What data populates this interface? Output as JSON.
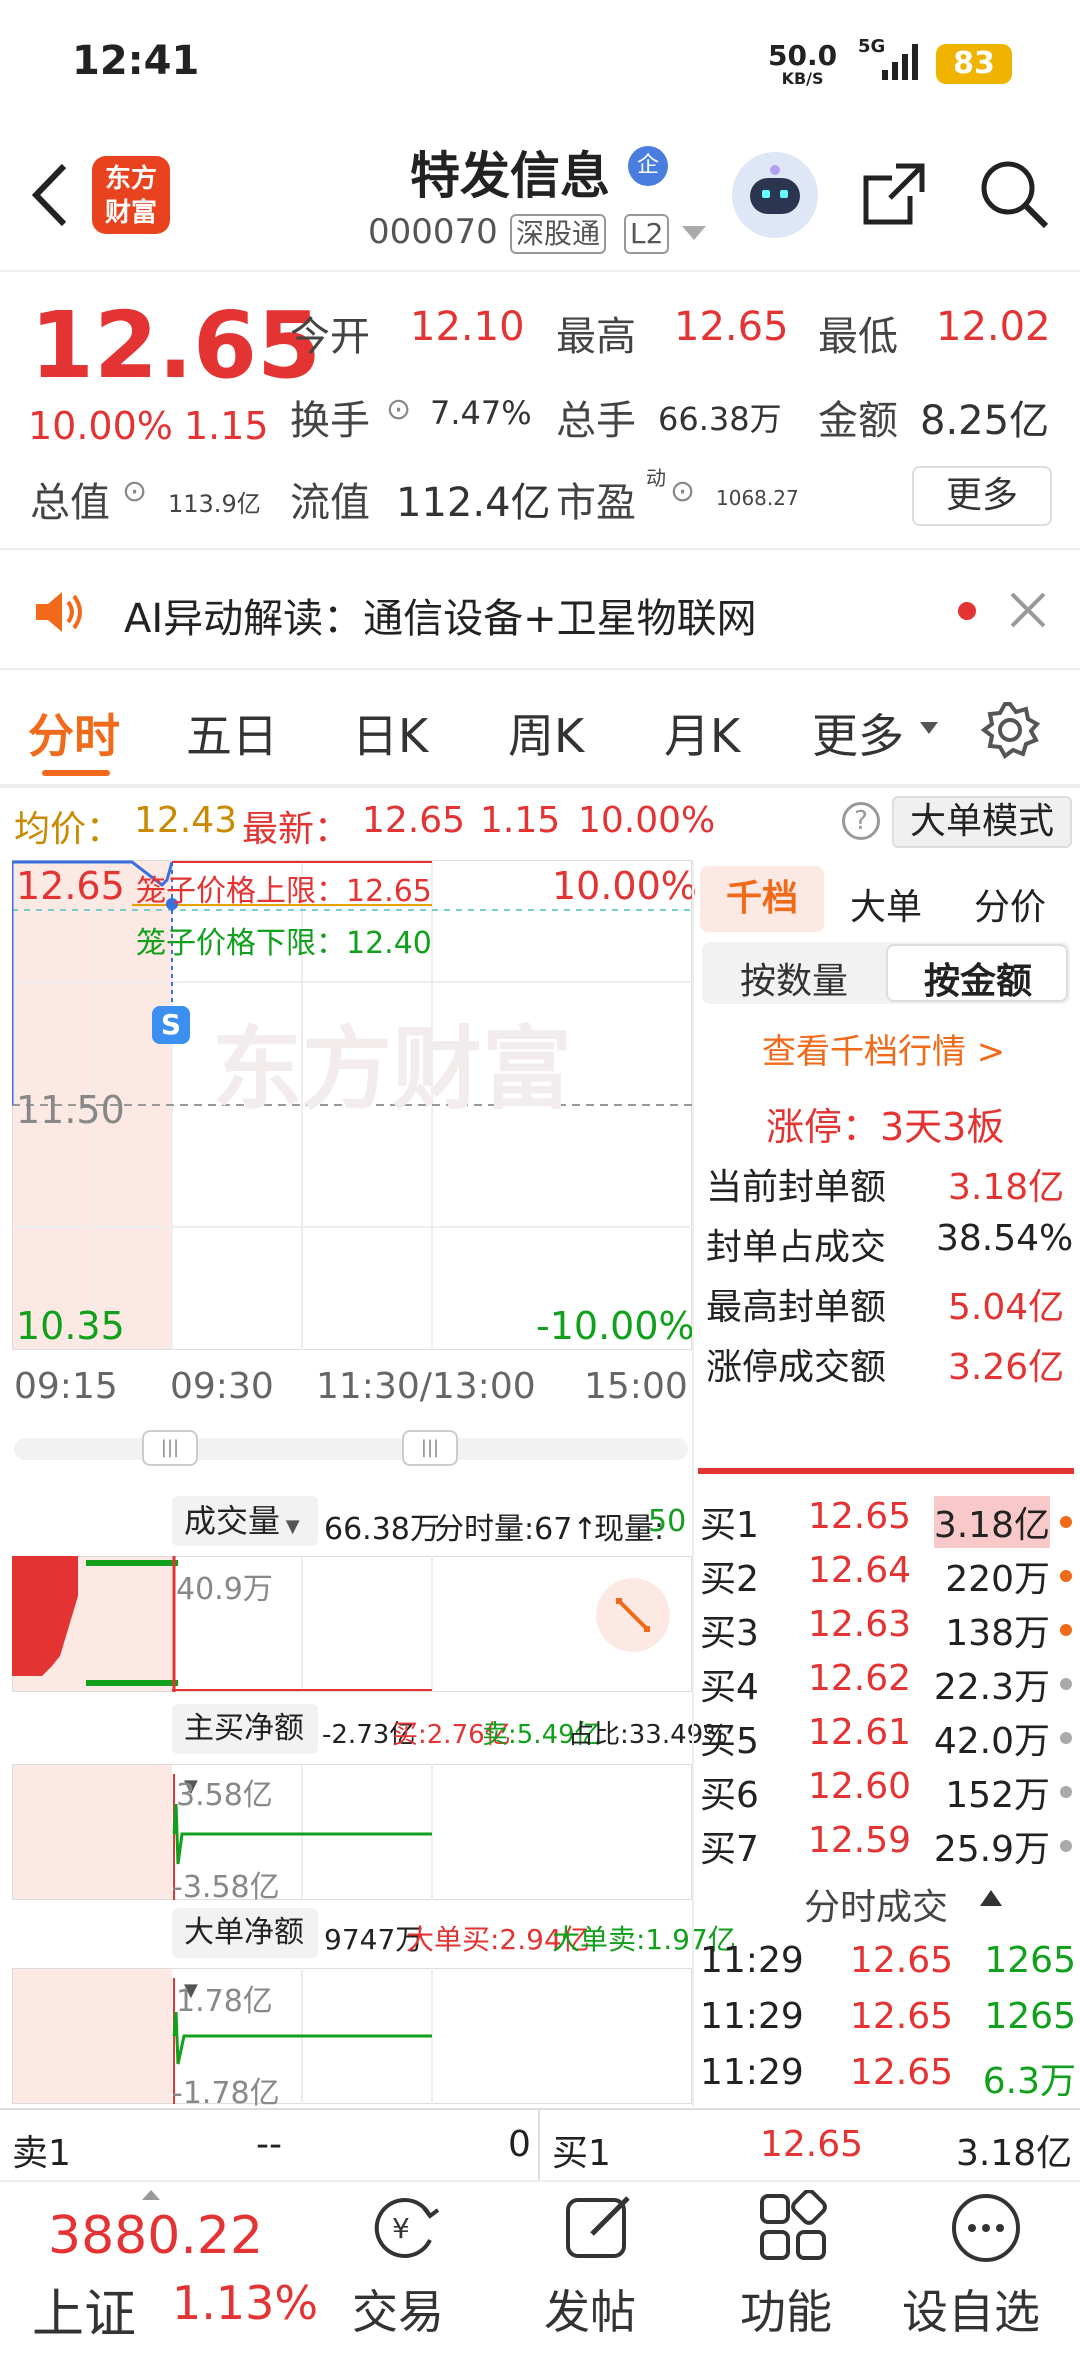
{
  "status_bar": {
    "time": "12:41",
    "speed": "50.0",
    "speed_unit": "KB/S",
    "network": "5G",
    "battery": "83"
  },
  "header": {
    "stock_name": "特发信息",
    "enterprise_badge": "企",
    "code": "000070",
    "tag1": "深股通",
    "tag2": "L2",
    "logo_line1": "东方",
    "logo_line2": "财富"
  },
  "quote": {
    "price": "12.65",
    "change_pct": "10.00%",
    "change": "1.15",
    "open_label": "今开",
    "open": "12.10",
    "high_label": "最高",
    "high": "12.65",
    "low_label": "最低",
    "low": "12.02",
    "turnover_label": "换手",
    "turnover": "7.47%",
    "volume_label": "总手",
    "volume": "66.38万",
    "amount_label": "金额",
    "amount": "8.25亿",
    "mktcap_label": "总值",
    "mktcap": "113.9亿",
    "float_label": "流值",
    "float": "112.4亿",
    "pe_label": "市盈",
    "pe_sup": "动",
    "pe": "1068.27",
    "more": "更多"
  },
  "ai_banner": {
    "text": "AI异动解读：通信设备+卫星物联网"
  },
  "tabs": [
    "分时",
    "五日",
    "日K",
    "周K",
    "月K",
    "更多"
  ],
  "avg_line": {
    "avg_label": "均价：",
    "avg": "12.43",
    "latest_label": "最新：",
    "latest": "12.65",
    "chg": "1.15",
    "pct": "10.00%",
    "mode": "大单模式"
  },
  "chart": {
    "top_price": "12.65",
    "top_pct": "10.00%",
    "upper_limit": "笼子价格上限：12.65",
    "lower_limit": "笼子价格下限：12.40",
    "mid_price": "11.50",
    "bottom_price": "10.35",
    "bottom_pct": "-10.00%",
    "s_marker": "S",
    "watermark": "东方财富",
    "times": [
      "09:15",
      "09:30",
      "11:30/13:00",
      "15:00"
    ]
  },
  "volume": {
    "selector": "成交量",
    "total": "66.38万",
    "minute_label": "分时量:67↑",
    "now_label": "现量:",
    "now": "50",
    "axis": "40.9万"
  },
  "netbuy": {
    "selector": "主买净额",
    "value": "-2.73亿",
    "buy": "买:2.76亿",
    "sell": "卖:5.49亿",
    "ratio": "占比:33.49%",
    "top": "3.58亿",
    "bottom": "-3.58亿"
  },
  "bigorder": {
    "selector": "大单净额",
    "value": "9747万",
    "buy": "大单买:2.94亿",
    "sell": "大单卖:1.97亿",
    "top": "1.78亿",
    "bottom": "-1.78亿"
  },
  "right_panel": {
    "tabs": [
      "千档",
      "大单",
      "分价"
    ],
    "sub_tabs": [
      "按数量",
      "按金额"
    ],
    "link": "查看千档行情 >",
    "limit_title": "涨停：3天3板",
    "stats": [
      {
        "label": "当前封单额",
        "value": "3.18亿"
      },
      {
        "label": "封单占成交",
        "value": "38.54%"
      },
      {
        "label": "最高封单额",
        "value": "5.04亿"
      },
      {
        "label": "涨停成交额",
        "value": "3.26亿"
      }
    ],
    "bids": [
      {
        "label": "买1",
        "price": "12.65",
        "qty": "3.18亿"
      },
      {
        "label": "买2",
        "price": "12.64",
        "qty": "220万"
      },
      {
        "label": "买3",
        "price": "12.63",
        "qty": "138万"
      },
      {
        "label": "买4",
        "price": "12.62",
        "qty": "22.3万"
      },
      {
        "label": "买5",
        "price": "12.61",
        "qty": "42.0万"
      },
      {
        "label": "买6",
        "price": "12.60",
        "qty": "152万"
      },
      {
        "label": "买7",
        "price": "12.59",
        "qty": "25.9万"
      }
    ],
    "trades_title": "分时成交",
    "trades": [
      {
        "time": "11:29",
        "price": "12.65",
        "qty": "1265"
      },
      {
        "time": "11:29",
        "price": "12.65",
        "qty": "1265"
      },
      {
        "time": "11:29",
        "price": "12.65",
        "qty": "6.3万"
      }
    ]
  },
  "bottom_bar": {
    "ask_label": "卖1",
    "ask_price": "--",
    "ask_qty": "0",
    "bid_label": "买1",
    "bid_price": "12.65",
    "bid_qty": "3.18亿"
  },
  "nav": {
    "index_value": "3880.22",
    "index_name": "上证",
    "index_pct": "1.13%",
    "items": [
      "交易",
      "发帖",
      "功能",
      "设自选"
    ]
  }
}
